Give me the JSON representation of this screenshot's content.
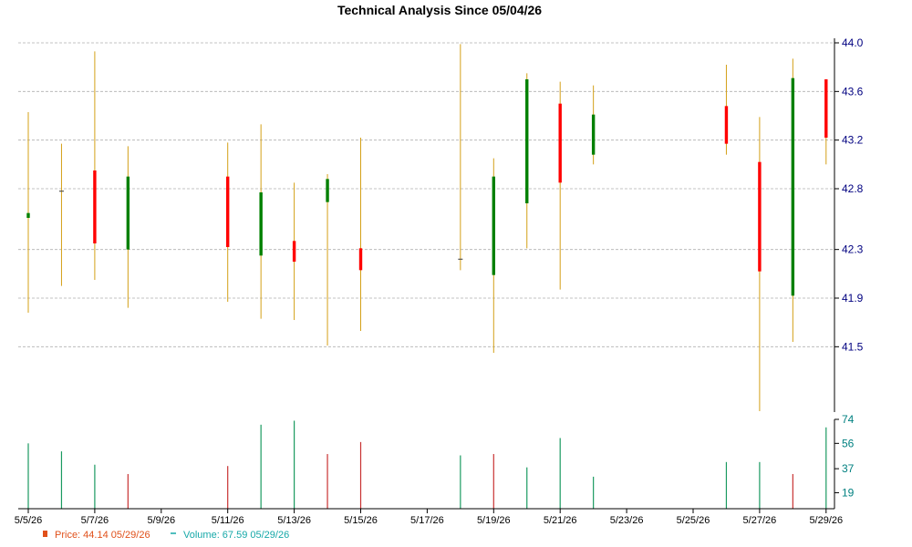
{
  "title": "Technical Analysis Since 05/04/26",
  "colors": {
    "wick": "#d4a017",
    "up": "#008000",
    "down": "#ff0000",
    "price_text": "#e0501a",
    "volume_text": "#16a8a8",
    "volume_up": "#1a9a60",
    "volume_down": "#c83232",
    "grid": "#b0b0b0",
    "axis": "#000000"
  },
  "legend": {
    "price_label": "Price: 44.14  05/29/26",
    "volume_label": "Volume: 67.59  05/29/26"
  },
  "chart_data": [
    {
      "type": "candlestick",
      "title": "Technical Analysis Since 05/04/26",
      "ylim": [
        41.0,
        44.0
      ],
      "yticks": [
        41.5,
        41.9,
        42.3,
        42.8,
        43.2,
        43.6,
        44.0
      ],
      "ytick_labels": [
        "41.5",
        "41.9",
        "42.3",
        "42.8",
        "43.2",
        "43.6",
        "44.0"
      ],
      "xlim": [
        0,
        24.5
      ],
      "xtick_positions": [
        0,
        2,
        4,
        6,
        8,
        10,
        12,
        14,
        16,
        18,
        20,
        22,
        24
      ],
      "xtick_labels": [
        "5/5/26",
        "5/7/26",
        "5/9/26",
        "5/11/26",
        "5/13/26",
        "5/15/26",
        "5/17/26",
        "5/19/26",
        "5/21/26",
        "5/23/26",
        "5/25/26",
        "5/27/26",
        "5/29/26"
      ],
      "grid": true,
      "candles": [
        {
          "date": "5/5/26",
          "x": 0,
          "open": 42.56,
          "high": 43.43,
          "low": 41.78,
          "close": 42.6
        },
        {
          "date": "5/6/26",
          "x": 1,
          "open": 42.78,
          "high": 43.17,
          "low": 42.0,
          "close": 42.78
        },
        {
          "date": "5/7/26",
          "x": 2,
          "open": 42.95,
          "high": 43.93,
          "low": 42.05,
          "close": 42.35
        },
        {
          "date": "5/8/26",
          "x": 3,
          "open": 42.3,
          "high": 43.15,
          "low": 41.82,
          "close": 42.9
        },
        {
          "date": "5/11/26",
          "x": 6,
          "open": 42.9,
          "high": 43.18,
          "low": 41.87,
          "close": 42.32
        },
        {
          "date": "5/12/26",
          "x": 7,
          "open": 42.25,
          "high": 43.33,
          "low": 41.73,
          "close": 42.77
        },
        {
          "date": "5/13/26",
          "x": 8,
          "open": 42.37,
          "high": 42.85,
          "low": 41.72,
          "close": 42.2
        },
        {
          "date": "5/14/26",
          "x": 9,
          "open": 42.69,
          "high": 42.92,
          "low": 41.51,
          "close": 42.88
        },
        {
          "date": "5/15/26",
          "x": 10,
          "open": 42.31,
          "high": 43.22,
          "low": 41.63,
          "close": 42.13
        },
        {
          "date": "5/18/26",
          "x": 13,
          "open": 42.22,
          "high": 43.99,
          "low": 42.13,
          "close": 42.22
        },
        {
          "date": "5/19/26",
          "x": 14,
          "open": 42.09,
          "high": 43.05,
          "low": 41.45,
          "close": 42.9
        },
        {
          "date": "5/20/26",
          "x": 15,
          "open": 42.68,
          "high": 43.75,
          "low": 42.31,
          "close": 43.7
        },
        {
          "date": "5/21/26",
          "x": 16,
          "open": 43.5,
          "high": 43.68,
          "low": 41.97,
          "close": 42.85
        },
        {
          "date": "5/22/26",
          "x": 17,
          "open": 43.08,
          "high": 43.65,
          "low": 43.0,
          "close": 43.41
        },
        {
          "date": "5/26/26",
          "x": 21,
          "open": 43.48,
          "high": 43.82,
          "low": 43.08,
          "close": 43.17
        },
        {
          "date": "5/27/26",
          "x": 22,
          "open": 43.02,
          "high": 43.39,
          "low": 40.97,
          "close": 42.12
        },
        {
          "date": "5/28/26",
          "x": 23,
          "open": 41.92,
          "high": 43.87,
          "low": 41.54,
          "close": 43.71
        },
        {
          "date": "5/29/26",
          "x": 24,
          "open": 43.7,
          "high": 43.7,
          "low": 43.0,
          "close": 43.22
        }
      ]
    },
    {
      "type": "bar",
      "ylim": [
        7,
        74
      ],
      "yticks": [
        19,
        37,
        56,
        74
      ],
      "ytick_labels": [
        "19",
        "37",
        "56",
        "74"
      ],
      "xlim": [
        0,
        24.5
      ],
      "bars": [
        {
          "x": 0,
          "value": 56,
          "dir": "up"
        },
        {
          "x": 1,
          "value": 50,
          "dir": "up"
        },
        {
          "x": 2,
          "value": 40,
          "dir": "up"
        },
        {
          "x": 3,
          "value": 33,
          "dir": "down"
        },
        {
          "x": 6,
          "value": 39,
          "dir": "down"
        },
        {
          "x": 7,
          "value": 70,
          "dir": "up"
        },
        {
          "x": 8,
          "value": 73,
          "dir": "up"
        },
        {
          "x": 9,
          "value": 48,
          "dir": "down"
        },
        {
          "x": 10,
          "value": 57,
          "dir": "down"
        },
        {
          "x": 13,
          "value": 47,
          "dir": "up"
        },
        {
          "x": 14,
          "value": 48,
          "dir": "down"
        },
        {
          "x": 15,
          "value": 38,
          "dir": "up"
        },
        {
          "x": 16,
          "value": 60,
          "dir": "up"
        },
        {
          "x": 17,
          "value": 31,
          "dir": "up"
        },
        {
          "x": 21,
          "value": 42,
          "dir": "up"
        },
        {
          "x": 22,
          "value": 42,
          "dir": "up"
        },
        {
          "x": 23,
          "value": 33,
          "dir": "down"
        },
        {
          "x": 24,
          "value": 68,
          "dir": "up"
        }
      ]
    }
  ]
}
